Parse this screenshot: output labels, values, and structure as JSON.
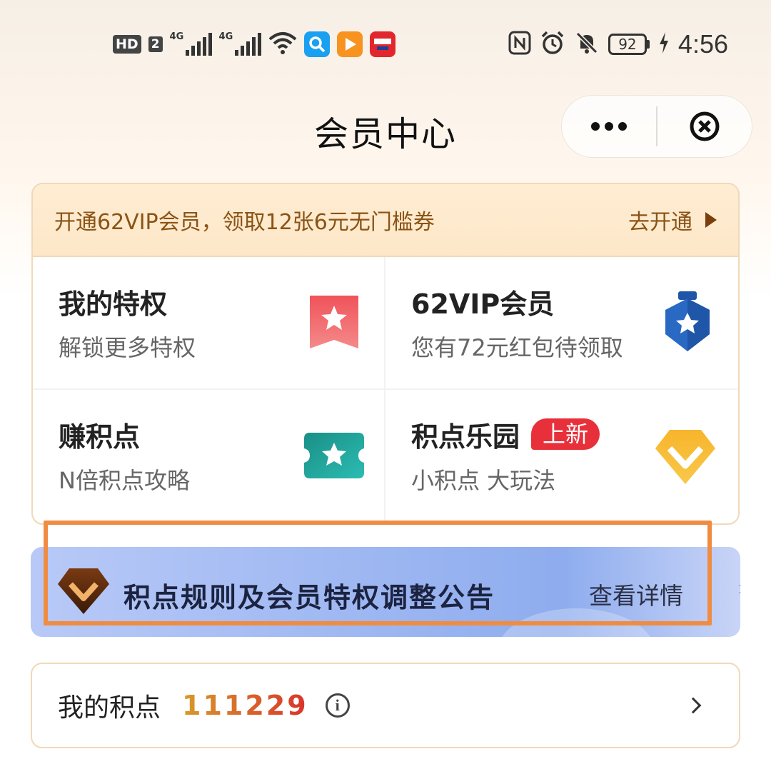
{
  "status_bar": {
    "hd": "HD",
    "sim": "2",
    "net1": "4G",
    "net2": "4G",
    "battery": "92",
    "time": "4:56",
    "left_icons": [
      "hd-badge",
      "sim2-badge",
      "signal-4g-icon",
      "signal-4g-icon",
      "wifi-icon",
      "search-app-icon",
      "video-app-icon",
      "cloud-pay-app-icon"
    ],
    "right_icons": [
      "nfc-icon",
      "alarm-icon",
      "mute-bell-icon",
      "battery-icon",
      "charging-icon"
    ]
  },
  "nav": {
    "title": "会员中心",
    "more_icon": "more-dots-icon",
    "close_icon": "close-circle-icon"
  },
  "promo": {
    "text": "开通62VIP会员，领取12张6元无门槛券",
    "cta": "去开通"
  },
  "grid": [
    {
      "title": "我的特权",
      "subtitle": "解锁更多特权",
      "icon": "red-bookmark-star-icon"
    },
    {
      "title": "62VIP会员",
      "subtitle": "您有72元红包待领取",
      "icon": "blue-shield-star-icon"
    },
    {
      "title": "赚积点",
      "subtitle": "N倍积点攻略",
      "icon": "teal-ticket-star-icon"
    },
    {
      "title": "积点乐园",
      "tag": "上新",
      "subtitle": "小积点 大玩法",
      "icon": "gold-diamond-icon"
    }
  ],
  "announcement": {
    "title": "积点规则及会员特权调整公告",
    "link": "查看详情",
    "icon": "bronze-diamond-icon"
  },
  "points": {
    "label": "我的积点",
    "value": "111229",
    "info_icon": "info-icon"
  },
  "colors": {
    "promo_text": "#8a5316",
    "new_tag": "#e8303a",
    "highlight_box": "#f08c41",
    "points_gradient_start": "#d89a2a",
    "points_gradient_end": "#d9332b"
  }
}
